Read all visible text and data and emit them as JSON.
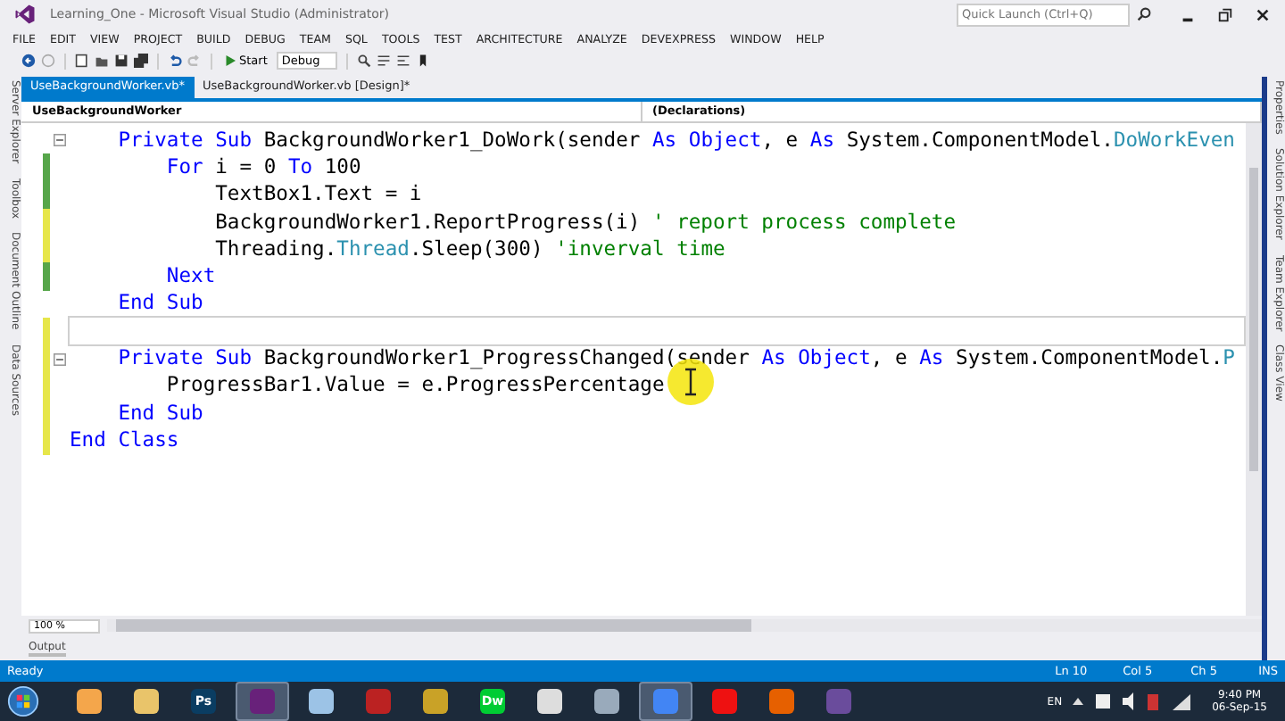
{
  "window": {
    "title": "Learning_One - Microsoft Visual Studio (Administrator)",
    "quick_launch": {
      "placeholder": "Quick Launch (Ctrl+Q)"
    }
  },
  "menu": [
    "FILE",
    "EDIT",
    "VIEW",
    "PROJECT",
    "BUILD",
    "DEBUG",
    "TEAM",
    "SQL",
    "TOOLS",
    "TEST",
    "ARCHITECTURE",
    "ANALYZE",
    "DEVEXPRESS",
    "WINDOW",
    "HELP"
  ],
  "toolbar": {
    "start": "Start",
    "configuration": "Debug"
  },
  "left_panels": [
    "Server Explorer",
    "Toolbox",
    "Document Outline",
    "Data Sources"
  ],
  "right_panels": [
    "Properties",
    "Solution Explorer",
    "Team Explorer",
    "Class View"
  ],
  "tabs": [
    {
      "label": "UseBackgroundWorker.vb*",
      "selected": true
    },
    {
      "label": "UseBackgroundWorker.vb [Design]*",
      "selected": false
    }
  ],
  "navigation": {
    "class": "UseBackgroundWorker",
    "member": "(Declarations)"
  },
  "code": [
    {
      "collapsible": true,
      "current": false,
      "segments": [
        {
          "kind": "keyword",
          "text": "    Private Sub"
        },
        {
          "kind": "plain",
          "text": " BackgroundWorker1_DoWork(sender "
        },
        {
          "kind": "keyword",
          "text": "As Object"
        },
        {
          "kind": "plain",
          "text": ", e "
        },
        {
          "kind": "keyword",
          "text": "As"
        },
        {
          "kind": "plain",
          "text": " System.ComponentModel."
        },
        {
          "kind": "type",
          "text": "DoWorkEven"
        }
      ]
    },
    {
      "collapsible": false,
      "current": false,
      "color": "#57a64a",
      "segments": [
        {
          "kind": "keyword",
          "text": "        For"
        },
        {
          "kind": "plain",
          "text": " i = 0 "
        },
        {
          "kind": "keyword",
          "text": "To"
        },
        {
          "kind": "plain",
          "text": " 100"
        }
      ]
    },
    {
      "collapsible": false,
      "current": false,
      "color": "#57a64a",
      "segments": [
        {
          "kind": "plain",
          "text": "            TextBox1.Text = i"
        }
      ]
    },
    {
      "collapsible": false,
      "current": false,
      "color": "#e6e64a",
      "segments": [
        {
          "kind": "plain",
          "text": "            BackgroundWorker1.ReportProgress(i) "
        },
        {
          "kind": "comment",
          "text": "' report process complete"
        }
      ]
    },
    {
      "collapsible": false,
      "current": false,
      "color": "#e6e64a",
      "segments": [
        {
          "kind": "plain",
          "text": "            Threading."
        },
        {
          "kind": "type",
          "text": "Thread"
        },
        {
          "kind": "plain",
          "text": ".Sleep(300) "
        },
        {
          "kind": "comment",
          "text": "'inverval time"
        }
      ]
    },
    {
      "collapsible": false,
      "current": false,
      "color": "#57a64a",
      "segments": [
        {
          "kind": "keyword",
          "text": "        Next"
        }
      ]
    },
    {
      "collapsible": false,
      "current": false,
      "segments": [
        {
          "kind": "keyword",
          "text": "    End Sub"
        }
      ]
    },
    {
      "collapsible": false,
      "current": true,
      "color": "#e6e64a"
    },
    {
      "collapsible": true,
      "current": false,
      "color": "#e6e64a",
      "segments": [
        {
          "kind": "keyword",
          "text": "    Private Sub"
        },
        {
          "kind": "plain",
          "text": " BackgroundWorker1_ProgressChanged(sender "
        },
        {
          "kind": "keyword",
          "text": "As Object"
        },
        {
          "kind": "plain",
          "text": ", e "
        },
        {
          "kind": "keyword",
          "text": "As"
        },
        {
          "kind": "plain",
          "text": " System.ComponentModel."
        },
        {
          "kind": "type",
          "text": "P"
        }
      ]
    },
    {
      "collapsible": false,
      "current": false,
      "color": "#e6e64a",
      "segments": [
        {
          "kind": "plain",
          "text": "        ProgressBar1.Value = e.ProgressPercentage"
        }
      ]
    },
    {
      "collapsible": false,
      "current": false,
      "color": "#e6e64a",
      "segments": [
        {
          "kind": "keyword",
          "text": "    End Sub"
        }
      ]
    },
    {
      "collapsible": false,
      "current": false,
      "color": "#e6e64a",
      "segments": [
        {
          "kind": "keyword",
          "text": "End Class"
        }
      ]
    }
  ],
  "zoom": "100 %",
  "bottom_panel": "Output",
  "status_bar": {
    "message": "Ready",
    "line": "Ln 10",
    "column": "Col 5",
    "char": "Ch 5",
    "mode": "INS"
  },
  "taskbar": {
    "apps": [
      {
        "kind": "media",
        "selected": false
      },
      {
        "kind": "folder",
        "selected": false
      },
      {
        "kind": "photoshop",
        "label": "Ps",
        "selected": false
      },
      {
        "kind": "visualstudio",
        "selected": true
      },
      {
        "kind": "cube",
        "selected": false
      },
      {
        "kind": "tool",
        "selected": false
      },
      {
        "kind": "tools",
        "selected": false
      },
      {
        "kind": "dreamweaver",
        "label": "Dw",
        "selected": false
      },
      {
        "kind": "window",
        "selected": false
      },
      {
        "kind": "disc",
        "selected": false
      },
      {
        "kind": "chrome",
        "selected": true
      },
      {
        "kind": "opera",
        "selected": false
      },
      {
        "kind": "firefox",
        "selected": false
      },
      {
        "kind": "eclipse",
        "selected": false
      }
    ],
    "language": "EN",
    "time": "9:40 PM",
    "date": "06-Sep-15"
  }
}
